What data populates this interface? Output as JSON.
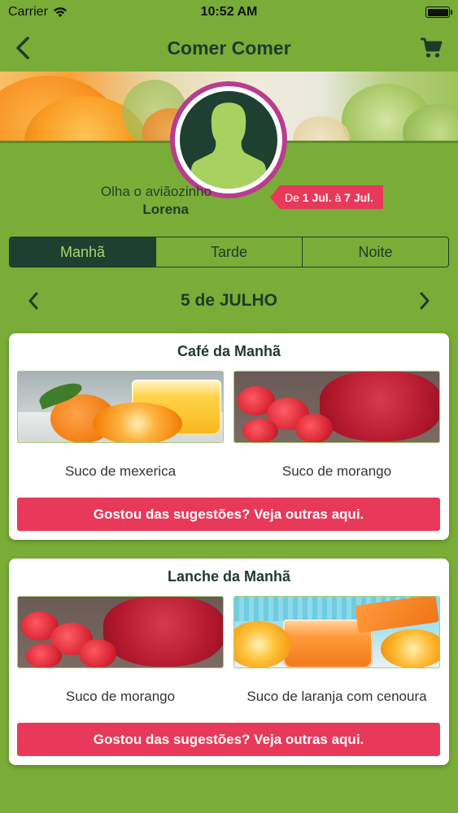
{
  "status_bar": {
    "carrier": "Carrier",
    "time": "10:52 AM"
  },
  "nav": {
    "title": "Comer Comer",
    "back_icon": "chevron-left-icon",
    "cart_icon": "cart-icon"
  },
  "profile": {
    "name": "Olha o aviãozinho",
    "user": "Lorena",
    "date_range": {
      "prefix": "De ",
      "start": "1 Jul.",
      "middle": " à ",
      "end": "7 Jul."
    }
  },
  "tabs": [
    {
      "label": "Manhã",
      "active": true
    },
    {
      "label": "Tarde",
      "active": false
    },
    {
      "label": "Noite",
      "active": false
    }
  ],
  "date_nav": {
    "title": "5 de JULHO"
  },
  "meals": [
    {
      "title": "Café da Manhã",
      "items": [
        {
          "caption": "Suco de mexerica"
        },
        {
          "caption": "Suco de morango"
        }
      ],
      "button_label": "Gostou das sugestões? Veja outras aqui."
    },
    {
      "title": "Lanche da Manhã",
      "items": [
        {
          "caption": "Suco de morango"
        },
        {
          "caption": "Suco de laranja com cenoura"
        }
      ],
      "button_label": "Gostou das sugestões? Veja outras aqui."
    }
  ],
  "colors": {
    "background": "#79ad37",
    "dark_green": "#1e4031",
    "accent_pink": "#e8395a",
    "avatar_ring": "#b83d8e"
  }
}
